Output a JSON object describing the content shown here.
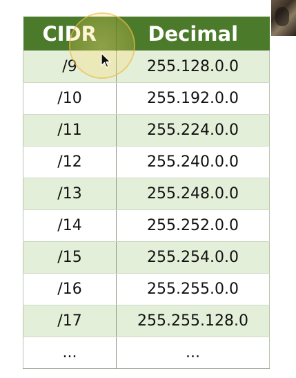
{
  "table": {
    "headers": [
      "CIDR",
      "Decimal"
    ],
    "rows": [
      {
        "cidr": "/9",
        "decimal": "255.128.0.0"
      },
      {
        "cidr": "/10",
        "decimal": "255.192.0.0"
      },
      {
        "cidr": "/11",
        "decimal": "255.224.0.0"
      },
      {
        "cidr": "/12",
        "decimal": "255.240.0.0"
      },
      {
        "cidr": "/13",
        "decimal": "255.248.0.0"
      },
      {
        "cidr": "/14",
        "decimal": "255.252.0.0"
      },
      {
        "cidr": "/15",
        "decimal": "255.254.0.0"
      },
      {
        "cidr": "/16",
        "decimal": "255.255.0.0"
      },
      {
        "cidr": "/17",
        "decimal": "255.255.128.0"
      },
      {
        "cidr": "...",
        "decimal": "..."
      }
    ]
  },
  "colors": {
    "header_bg": "#4a7a2a",
    "row_shade": "#e4efd9",
    "row_plain": "#ffffff",
    "cursor_highlight": "#ffd65f"
  },
  "icons": {
    "cursor": "mouse-pointer-icon"
  }
}
